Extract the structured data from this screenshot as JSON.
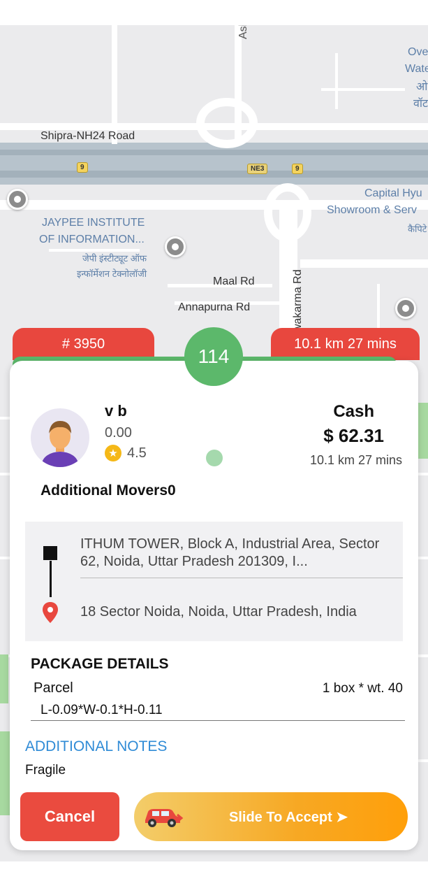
{
  "map": {
    "labels": {
      "road1": "Shipra-NH24 Road",
      "ashok": "Ashok",
      "overwater": "Ove",
      "water": "Wate",
      "hindi1": "ओ",
      "hindi2": "वॉट",
      "capital1": "Capital Hyu",
      "capital2": "Showroom & Serv",
      "capital3": "कैपिटे",
      "jaypee1": "JAYPEE INSTITUTE",
      "jaypee2": "OF INFORMATION...",
      "jaypee3": "जेपी इंस्टीट्यूट ऑफ",
      "jaypee4": "इन्फॉर्मेशन टेक्नोलॉजी",
      "maal": "Maal Rd",
      "annapurna": "Annapurna Rd",
      "vishwakarma": "Vishwakarma Rd",
      "shield9a": "9",
      "shield9b": "9",
      "shieldNE3": "NE3"
    }
  },
  "ride": {
    "id_label": "# 3950",
    "distance_tab": "10.1 km 27 mins",
    "timer": "114"
  },
  "customer": {
    "name": "v b",
    "balance": "0.00",
    "rating": "4.5",
    "payment_method": "Cash",
    "price": "$ 62.31",
    "distance": "10.1 km 27 mins",
    "additional_movers": "Additional Movers0"
  },
  "route": {
    "pickup": "ITHUM TOWER, Block A, Industrial Area, Sector 62, Noida, Uttar Pradesh 201309, I...",
    "drop": "18 Sector Noida, Noida, Uttar Pradesh, India"
  },
  "package": {
    "title": "PACKAGE DETAILS",
    "type": "Parcel",
    "quantity": "1 box * wt. 40",
    "dimensions": "L-0.09*W-0.1*H-0.11"
  },
  "notes": {
    "title": "ADDITIONAL NOTES",
    "text": "Fragile"
  },
  "actions": {
    "cancel_label": "Cancel",
    "accept_label": "Slide To Accept ➤"
  },
  "colors": {
    "accent_red": "#e8473e",
    "accent_green": "#5cb86b",
    "link_blue": "#2f8bd6",
    "slider_orange": "#f7a823"
  }
}
